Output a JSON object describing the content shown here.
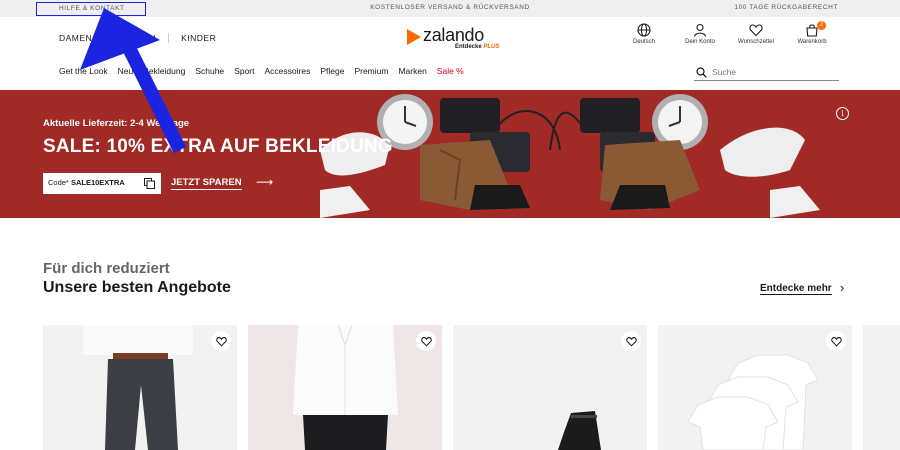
{
  "topbar": {
    "help_label": "HILFE & KONTAKT",
    "shipping_label": "KOSTENLOSER VERSAND & RÜCKVERSAND",
    "return_label": "100 TAGE RÜCKGABERECHT"
  },
  "header": {
    "gender_tabs": [
      "DAMEN",
      "HERREN",
      "KINDER"
    ],
    "logo_text": "zalando",
    "logo_sub": "Entdecke",
    "logo_sub_plus": "PLUS",
    "icons": [
      {
        "label": "Deutsch",
        "icon": "globe-icon"
      },
      {
        "label": "Dein Konto",
        "icon": "user-icon"
      },
      {
        "label": "Wunschzettel",
        "icon": "heart-icon"
      },
      {
        "label": "Warenkorb",
        "icon": "bag-icon"
      }
    ],
    "cart_count": "2"
  },
  "nav": {
    "categories": [
      "Get the Look",
      "Neu",
      "Bekleidung",
      "Schuhe",
      "Sport",
      "Accessoires",
      "Pflege",
      "Premium",
      "Marken"
    ],
    "sale_label": "Sale %",
    "search_placeholder": "Suche"
  },
  "banner": {
    "delivery_text": "Aktuelle Lieferzeit: 2-4 Werktage",
    "headline": "SALE: 10% EXTRA AUF BEKLEIDUNG",
    "code_label": "Code*",
    "code_value": "SALE10EXTRA",
    "cta_label": "JETZT SPAREN",
    "color": "#a22a26"
  },
  "section": {
    "subtitle": "Für dich reduziert",
    "title": "Unsere besten Angebote",
    "more_label": "Entdecke mehr"
  },
  "colors": {
    "accent": "#ff6900",
    "sale": "#e5001a",
    "annotation": "#1b24e0"
  }
}
